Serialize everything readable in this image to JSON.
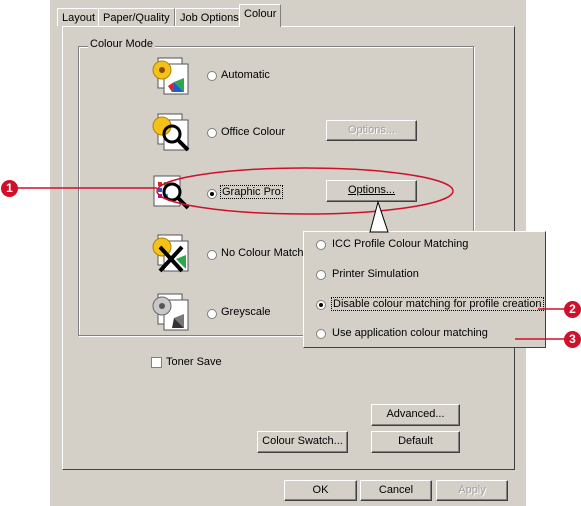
{
  "tabs": [
    {
      "label": "Layout"
    },
    {
      "label": "Paper/Quality"
    },
    {
      "label": "Job Options"
    },
    {
      "label": "Colour"
    }
  ],
  "colour_mode": {
    "title": "Colour Mode",
    "options": [
      {
        "label": "Automatic",
        "selected": false
      },
      {
        "label": "Office Colour",
        "selected": false,
        "options_button": "Options...",
        "options_enabled": false
      },
      {
        "label": "Graphic Pro",
        "selected": true,
        "options_button": "Options...",
        "options_enabled": true
      },
      {
        "label": "No Colour Match",
        "selected": false
      },
      {
        "label": "Greyscale",
        "selected": false
      }
    ]
  },
  "popup": {
    "items": [
      {
        "label": "ICC Profile Colour Matching",
        "selected": false
      },
      {
        "label": "Printer Simulation",
        "selected": false
      },
      {
        "label": "Disable colour matching for profile creation",
        "selected": true
      },
      {
        "label": "Use application colour matching",
        "selected": false
      }
    ]
  },
  "toner_save": {
    "label": "Toner Save",
    "checked": false
  },
  "buttons": {
    "advanced": "Advanced...",
    "colour_swatch": "Colour Swatch...",
    "default": "Default",
    "ok": "OK",
    "cancel": "Cancel",
    "apply": "Apply"
  },
  "callouts": [
    "1",
    "2",
    "3"
  ],
  "colors": {
    "callout": "#d0102a",
    "dialog_bg": "#d4d0c8"
  }
}
